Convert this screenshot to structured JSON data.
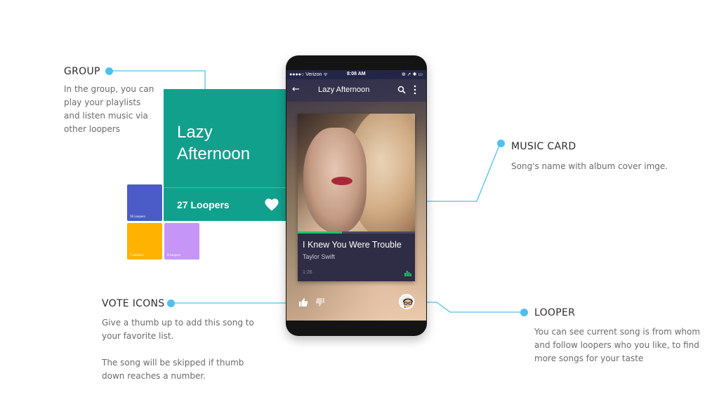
{
  "annotations": {
    "group": {
      "title": "GROUP",
      "body": [
        "In the group, you can",
        "play your playlists",
        "and listen music via",
        "other loopers"
      ]
    },
    "music_card": {
      "title": "MUSIC CARD",
      "body": [
        "Song's name with album cover imge."
      ]
    },
    "vote_icons": {
      "title": "VOTE ICONS",
      "body": [
        "Give a thumb up to add this song to",
        "your favorite list.",
        "",
        "The song will be skipped if thumb",
        "down reaches a number."
      ]
    },
    "looper": {
      "title": "LOOPER",
      "body": [
        "You can see current song is from whom",
        "and follow loopers who you like, to find",
        "more songs for your taste"
      ]
    }
  },
  "group_card": {
    "title_line1": "Lazy",
    "title_line2": "Afternoon",
    "count": "27 Loopers",
    "color": "#11a08c"
  },
  "mini_cards": [
    {
      "label": "16 Loopers",
      "color": "#4b5bc7"
    },
    {
      "label": "7 Loopers",
      "color": "#ffb300"
    },
    {
      "label": "8 Loopers",
      "color": "#c595f7"
    }
  ],
  "phone": {
    "status": {
      "carrier": "●●●●○ Verizon ᯤ",
      "time": "8:08 AM",
      "right": "⊕ ➚ ✱ ▭"
    },
    "appbar": {
      "back": "←",
      "title": "Lazy Afternoon"
    },
    "song": {
      "title": "I Knew You Were Trouble",
      "artist": "Taylor Swift",
      "duration": "1:26",
      "progress": 0.38
    }
  },
  "colors": {
    "accent": "#4fc0ee",
    "progress": "#22c26b",
    "card_bg": "#2f2c45"
  },
  "icons": [
    "heart-icon",
    "back-arrow-icon",
    "search-icon",
    "more-vert-icon",
    "thumb-up-icon",
    "thumb-down-icon",
    "equalizer-icon",
    "looper-avatar"
  ]
}
